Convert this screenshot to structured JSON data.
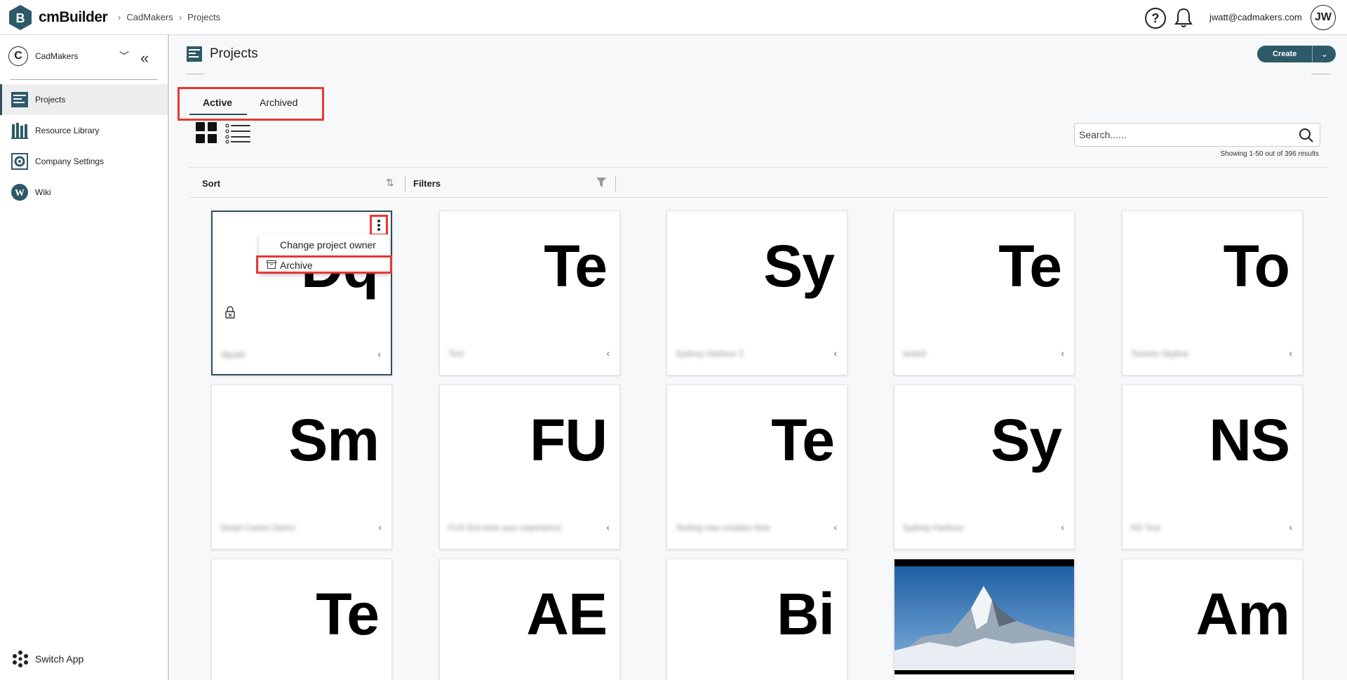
{
  "topbar": {
    "brand": "cmBuilder",
    "breadcrumb": [
      "CadMakers",
      "Projects"
    ],
    "help_icon": "?",
    "user_email": "jwatt@cadmakers.com",
    "avatar_initials": "JW"
  },
  "sidebar": {
    "org_initial": "C",
    "org_name": "CadMakers",
    "items": [
      {
        "label": "Projects",
        "icon": "projects-icon",
        "active": true
      },
      {
        "label": "Resource Library",
        "icon": "library-icon",
        "active": false
      },
      {
        "label": "Company Settings",
        "icon": "settings-icon",
        "active": false
      },
      {
        "label": "Wiki",
        "icon": "wiki-icon",
        "active": false
      }
    ],
    "switch_app": "Switch App"
  },
  "page": {
    "title": "Projects",
    "create_label": "Create",
    "tabs": [
      {
        "label": "Active",
        "active": true
      },
      {
        "label": "Archived",
        "active": false
      }
    ],
    "search_placeholder": "Search......",
    "results_text": "Showing 1-50 out of 396 results",
    "sort_label": "Sort",
    "filters_label": "Filters"
  },
  "context_menu": {
    "items": [
      "Change project owner",
      "Archive"
    ],
    "highlighted": "Archive"
  },
  "cards": [
    {
      "abbr": "Dq",
      "name": "dquad",
      "selected": true,
      "locked": true
    },
    {
      "abbr": "Te",
      "name": "Test"
    },
    {
      "abbr": "Sy",
      "name": "Sydney Harbour 2"
    },
    {
      "abbr": "Te",
      "name": "tested"
    },
    {
      "abbr": "To",
      "name": "Toronto Skyline"
    },
    {
      "abbr": "Sm",
      "name": "Smart Carton Demo"
    },
    {
      "abbr": "FU",
      "name": "FUX first time user experience"
    },
    {
      "abbr": "Te",
      "name": "Testing new creation flow"
    },
    {
      "abbr": "Sy",
      "name": "Sydney Harbour"
    },
    {
      "abbr": "NS",
      "name": "NS Test"
    },
    {
      "abbr": "Te",
      "name": ""
    },
    {
      "abbr": "AE",
      "name": ""
    },
    {
      "abbr": "Bi",
      "name": ""
    },
    {
      "abbr": "",
      "name": "",
      "photo": "mountain"
    },
    {
      "abbr": "Am",
      "name": ""
    }
  ],
  "colors": {
    "accent": "#2d5a68",
    "highlight": "#e53935"
  }
}
